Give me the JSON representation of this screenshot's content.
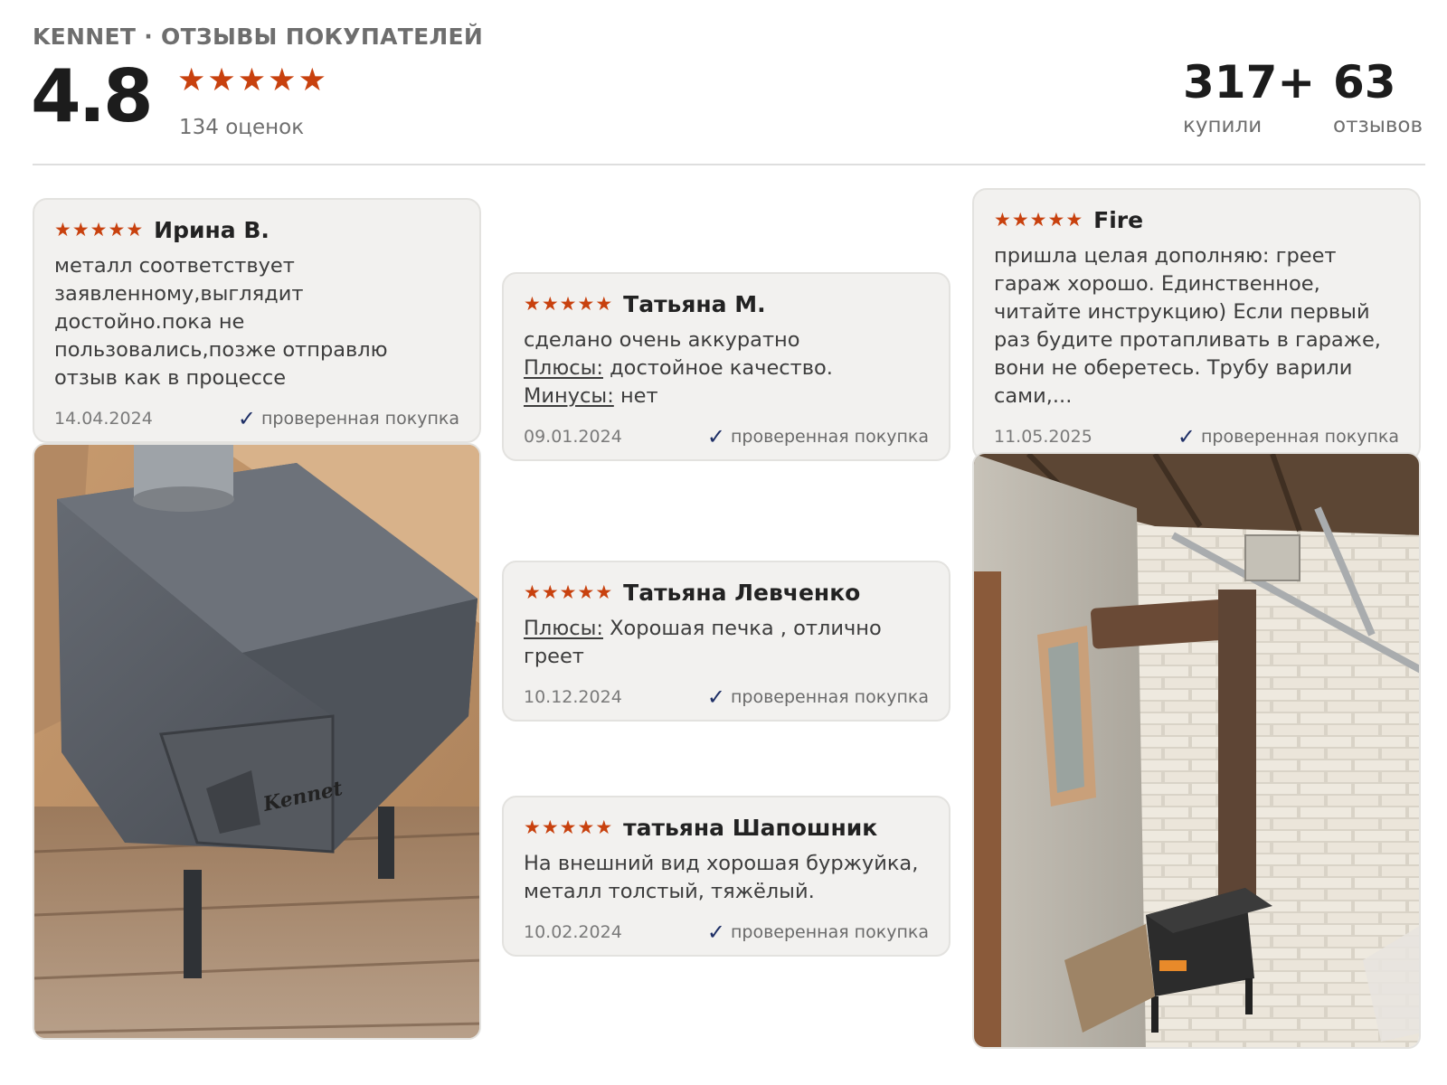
{
  "header": {
    "brand": "KENNET · ОТЗЫВЫ ПОКУПАТЕЛЕЙ",
    "rating": "4.8",
    "stars": 5,
    "ratings_count": "134 оценок",
    "bought_value": "317+",
    "bought_label": "купили",
    "reviews_value": "63",
    "reviews_label": "отзывов"
  },
  "colors": {
    "star": "#c8410e",
    "check": "#1e2f66",
    "card_bg": "#f2f1ef"
  },
  "icons": {
    "star": "star-icon",
    "check": "checkmark-icon"
  },
  "reviews": [
    {
      "author": "Ирина В.",
      "stars": 5,
      "text": "металл соответствует заявленному,выглядит достойно.пока не пользовались,позже отправлю отзыв как в процессе",
      "date": "14.04.2024",
      "verified": "проверенная покупка"
    },
    {
      "author": "Татьяна М.",
      "stars": 5,
      "text": "сделано очень аккуратно",
      "pros_label": "Плюсы:",
      "pros": "достойное качество.",
      "cons_label": "Минусы:",
      "cons": "нет",
      "date": "09.01.2024",
      "verified": "проверенная покупка"
    },
    {
      "author": "Татьяна Левченко",
      "stars": 5,
      "pros_label": "Плюсы:",
      "pros": "Хорошая печка , отлично греет",
      "date": "10.12.2024",
      "verified": "проверенная покупка"
    },
    {
      "author": "татьяна Шапошник",
      "stars": 5,
      "text": "На внешний вид хорошая буржуйка, металл толстый, тяжёлый.",
      "date": "10.02.2024",
      "verified": "проверенная покупка"
    },
    {
      "author": "Fire",
      "stars": 5,
      "text": "пришла целая дополняю: греет гараж хорошо. Единственное, читайте инструкцию) Если первый раз будите протапливать в гараже, вони не оберетесь. Трубу варили сами,...",
      "date": "11.05.2025",
      "verified": "проверенная покупка"
    }
  ],
  "photos": [
    {
      "logo_text": "Kennet"
    },
    {
      "logo_text": ""
    }
  ]
}
